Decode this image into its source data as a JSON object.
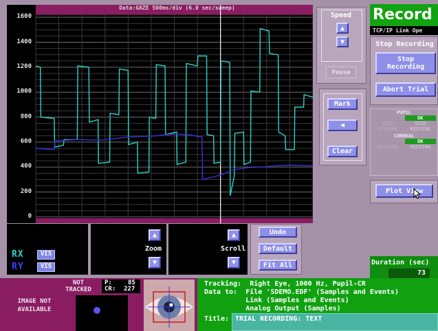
{
  "plot": {
    "title": "Data:GAZE    500ms/div (6.0 sec/sweep)",
    "y_ticks": [
      "1600",
      "1400",
      "1200",
      "1000",
      "800",
      "600",
      "400",
      "200",
      "0"
    ]
  },
  "speed": {
    "label": "Speed",
    "pause_label": "Pause"
  },
  "marks": {
    "mark_label": "Mark",
    "clear_label": "Clear"
  },
  "record": {
    "title": "Record",
    "link_status": "TCP/IP Link Ope",
    "stop_section_label": "Stop Recording",
    "stop_button": "Stop Recording",
    "abort_button": "Abort Trial",
    "plot_view_button": "Plot View"
  },
  "status": {
    "pupil_label": "PUPIL",
    "corneal_label": "CORNEAL",
    "ok": "OK",
    "size": "SIZE",
    "missing": "MISSING"
  },
  "duration": {
    "label": "Duration (sec)",
    "value": "73"
  },
  "channels": [
    {
      "name": "RX",
      "vis": "VIS",
      "color": "#2fd4c8"
    },
    {
      "name": "RY",
      "vis": "VIS",
      "color": "#2f2fe0"
    }
  ],
  "controls": {
    "zoom_label": "Zoom",
    "scroll_label": "Scroll",
    "undo_label": "Undo",
    "default_label": "Default",
    "fit_all_label": "Fit All"
  },
  "camera": {
    "image_status": "IMAGE NOT AVAILABLE",
    "tracked_status": "NOT TRACKED",
    "p_label": "P:",
    "p_value": "85",
    "cr_label": "CR:",
    "cr_value": "227"
  },
  "info": {
    "tracking": "Tracking:  Right Eye, 1000 Hz, Pupil-CR",
    "data_to": "Data to:  File 'SDEMO.EDF' (Samples and Events)",
    "link": "          Link (Samples and Events)",
    "analog": "          Analog Output (Samples)",
    "title_label": "Title:",
    "title_value": "TRIAL RECORDING: TEXT"
  },
  "colors": {
    "background": "#a592a8",
    "plot_band": "#8a1d62",
    "trace_x": "#2fd4c8",
    "trace_y": "#3a32e0",
    "button": "#8d8fe8",
    "record_green": "#11a311"
  },
  "chart_data": {
    "type": "line",
    "title": "Data:GAZE    500ms/div (6.0 sec/sweep)",
    "ylim": [
      -50,
      1700
    ],
    "y_ticks": [
      0,
      200,
      400,
      600,
      800,
      1000,
      1200,
      1400,
      1600
    ],
    "xlim": [
      0,
      6.0
    ],
    "cursor_x": 4.0,
    "series": [
      {
        "name": "RX",
        "color": "#2fd4c8",
        "points": [
          [
            0.0,
            1210
          ],
          [
            0.1,
            1200
          ],
          [
            0.11,
            800
          ],
          [
            0.4,
            790
          ],
          [
            0.41,
            560
          ],
          [
            0.6,
            575
          ],
          [
            0.61,
            620
          ],
          [
            0.9,
            620
          ],
          [
            0.91,
            1210
          ],
          [
            1.15,
            1200
          ],
          [
            1.16,
            760
          ],
          [
            1.35,
            780
          ],
          [
            1.36,
            430
          ],
          [
            1.6,
            440
          ],
          [
            1.61,
            830
          ],
          [
            1.8,
            820
          ],
          [
            1.81,
            1185
          ],
          [
            2.0,
            1175
          ],
          [
            2.01,
            580
          ],
          [
            2.2,
            600
          ],
          [
            2.21,
            350
          ],
          [
            2.45,
            360
          ],
          [
            2.46,
            800
          ],
          [
            2.6,
            790
          ],
          [
            2.61,
            1220
          ],
          [
            2.8,
            1210
          ],
          [
            2.81,
            660
          ],
          [
            3.05,
            680
          ],
          [
            3.06,
            420
          ],
          [
            3.25,
            440
          ],
          [
            3.26,
            1230
          ],
          [
            3.5,
            1210
          ],
          [
            3.51,
            1290
          ],
          [
            3.7,
            1290
          ],
          [
            3.71,
            660
          ],
          [
            3.85,
            650
          ],
          [
            3.86,
            430
          ],
          [
            4.0,
            440
          ],
          [
            4.01,
            1250
          ],
          [
            4.2,
            1240
          ],
          [
            4.21,
            170
          ],
          [
            4.3,
            330
          ],
          [
            4.31,
            670
          ],
          [
            4.5,
            680
          ],
          [
            4.51,
            420
          ],
          [
            4.65,
            440
          ],
          [
            4.66,
            1010
          ],
          [
            4.85,
            1000
          ],
          [
            4.86,
            1510
          ],
          [
            5.05,
            1490
          ],
          [
            5.06,
            1310
          ],
          [
            5.25,
            1300
          ],
          [
            5.26,
            680
          ],
          [
            5.4,
            650
          ],
          [
            5.41,
            540
          ],
          [
            5.6,
            540
          ],
          [
            5.61,
            880
          ],
          [
            5.8,
            880
          ],
          [
            5.81,
            980
          ],
          [
            6.0,
            960
          ]
        ]
      },
      {
        "name": "RY",
        "color": "#3a32e0",
        "points": [
          [
            0.0,
            550
          ],
          [
            0.4,
            540
          ],
          [
            0.41,
            610
          ],
          [
            0.9,
            620
          ],
          [
            1.4,
            615
          ],
          [
            2.0,
            640
          ],
          [
            2.6,
            650
          ],
          [
            3.0,
            665
          ],
          [
            3.3,
            660
          ],
          [
            3.6,
            640
          ],
          [
            3.61,
            300
          ],
          [
            4.0,
            335
          ],
          [
            4.3,
            380
          ],
          [
            4.6,
            395
          ],
          [
            4.9,
            400
          ],
          [
            5.2,
            410
          ],
          [
            5.5,
            415
          ],
          [
            6.0,
            410
          ]
        ]
      }
    ]
  }
}
